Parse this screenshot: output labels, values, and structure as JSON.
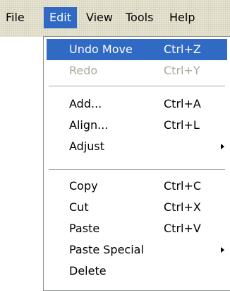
{
  "menubar": {
    "items": [
      {
        "label": "File"
      },
      {
        "label": "Edit"
      },
      {
        "label": "View"
      },
      {
        "label": "Tools"
      },
      {
        "label": "Help"
      }
    ],
    "active": "Edit"
  },
  "edit_menu": {
    "items": [
      {
        "label": "Undo Move",
        "shortcut": "Ctrl+Z",
        "state": "highlighted"
      },
      {
        "label": "Redo",
        "shortcut": "Ctrl+Y",
        "state": "disabled"
      },
      {
        "label": "Add...",
        "shortcut": "Ctrl+A"
      },
      {
        "label": "Align...",
        "shortcut": "Ctrl+L"
      },
      {
        "label": "Adjust",
        "submenu": true
      },
      {
        "label": "Copy",
        "shortcut": "Ctrl+C"
      },
      {
        "label": "Cut",
        "shortcut": "Ctrl+X"
      },
      {
        "label": "Paste",
        "shortcut": "Ctrl+V"
      },
      {
        "label": "Paste Special",
        "submenu": true
      },
      {
        "label": "Delete"
      }
    ]
  },
  "colors": {
    "highlight": "#316ac5",
    "menubar_bg": "#ece9d8",
    "disabled_text": "#aca899"
  }
}
